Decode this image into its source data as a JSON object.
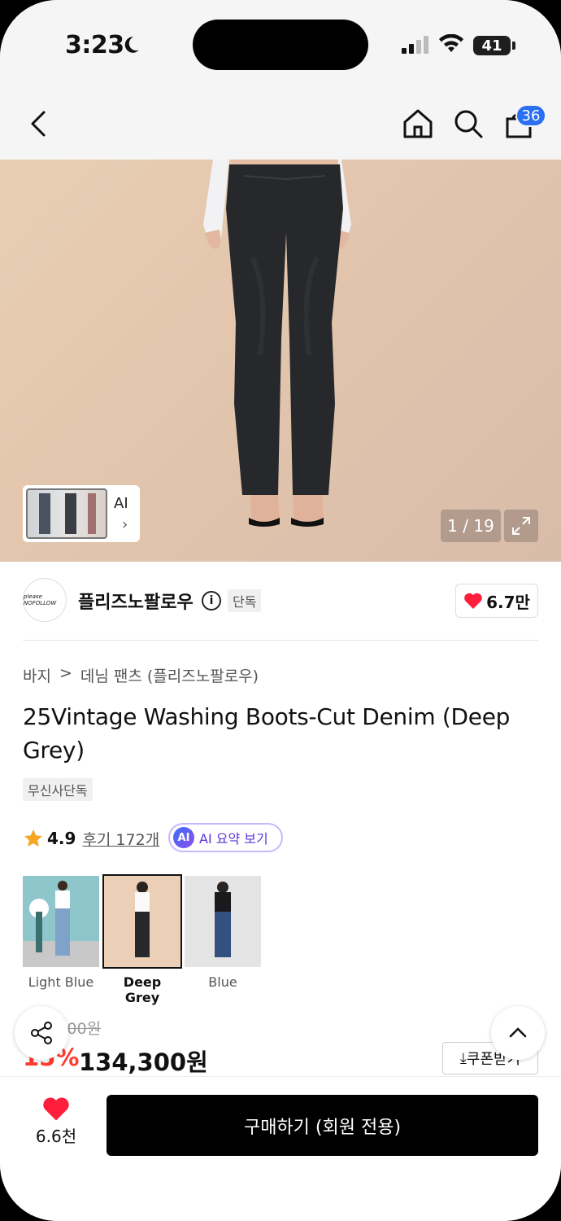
{
  "status_bar": {
    "time": "3:23",
    "battery": "41"
  },
  "header": {
    "cart_count": "36",
    "icons": [
      "back-icon",
      "home-icon",
      "search-icon",
      "cart-icon"
    ]
  },
  "gallery": {
    "ai_label": "AI",
    "counter": "1 / 19"
  },
  "brand": {
    "name": "플리즈노팔로우",
    "exclusive": "단독",
    "likes": "6.7만",
    "logo_text": "please NOFOLLOW"
  },
  "breadcrumb": {
    "category": "바지",
    "separator": ">",
    "subcategory": "데님 팬츠 (플리즈노팔로우)"
  },
  "product": {
    "title": "25Vintage Washing Boots-Cut Denim (Deep Grey)",
    "tag": "무신사단독",
    "rating": "4.9",
    "reviews": "후기 172개",
    "ai_summary": "AI 요약 보기",
    "ai_badge": "AI"
  },
  "colors": [
    {
      "label": "Light Blue",
      "selected": false
    },
    {
      "label": "Deep Grey",
      "selected": true
    },
    {
      "label": "Blue",
      "selected": false
    }
  ],
  "price": {
    "original": "158,000원",
    "discount": "15%",
    "current": "134,300원",
    "coupon": "쿠폰받기"
  },
  "bottom": {
    "wish_count": "6.6천",
    "buy_label": "구매하기 (회원 전용)"
  },
  "accent_colors": {
    "heart": "#ff1f3d",
    "discount": "#ff3b30",
    "badge": "#2b6ff3",
    "ai_purple": "#5a35d8"
  }
}
